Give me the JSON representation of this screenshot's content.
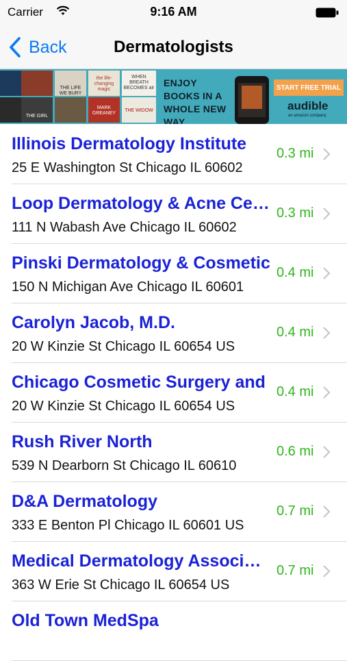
{
  "status_bar": {
    "carrier": "Carrier",
    "time": "9:16 AM"
  },
  "nav": {
    "back_label": "Back",
    "title": "Dermatologists"
  },
  "ad": {
    "slogan": "ENJOY BOOKS IN A WHOLE NEW WAY.",
    "cta": "START FREE TRIAL",
    "brand": "audible",
    "brand_sub": "an amazon company",
    "book_titles": [
      "THE LIFE WE BURY",
      "the life-changing magic",
      "WHEN BREATH BECOMES air",
      "MARK GREANEY",
      "THE WIDOW",
      "THE GIRL"
    ]
  },
  "colors": {
    "link_blue": "#0a79f3",
    "name_blue": "#1a22d6",
    "distance_green": "#2fb51b",
    "ad_teal": "#43aabb"
  },
  "results": [
    {
      "name": "Illinois Dermatology Institute",
      "address": "25 E Washington St Chicago IL 60602",
      "distance": "0.3 mi"
    },
    {
      "name": "Loop Dermatology & Acne Center",
      "address": "111 N Wabash Ave Chicago IL 60602",
      "distance": "0.3 mi"
    },
    {
      "name": "Pinski Dermatology & Cosmetic",
      "address": "150 N Michigan Ave Chicago IL 60601",
      "distance": "0.4 mi"
    },
    {
      "name": "Carolyn Jacob, M.D.",
      "address": "20 W Kinzie St Chicago IL 60654 US",
      "distance": "0.4 mi"
    },
    {
      "name": "Chicago Cosmetic Surgery and",
      "address": "20 W Kinzie St Chicago IL 60654 US",
      "distance": "0.4 mi"
    },
    {
      "name": "Rush River North",
      "address": "539 N Dearborn St Chicago IL 60610",
      "distance": "0.6 mi"
    },
    {
      "name": "D&A Dermatology",
      "address": "333 E Benton Pl Chicago IL 60601 US",
      "distance": "0.7 mi"
    },
    {
      "name": "Medical Dermatology Associates",
      "address": "363 W Erie St Chicago IL 60654 US",
      "distance": "0.7 mi"
    },
    {
      "name": "Old Town MedSpa",
      "address": "",
      "distance": ""
    }
  ]
}
